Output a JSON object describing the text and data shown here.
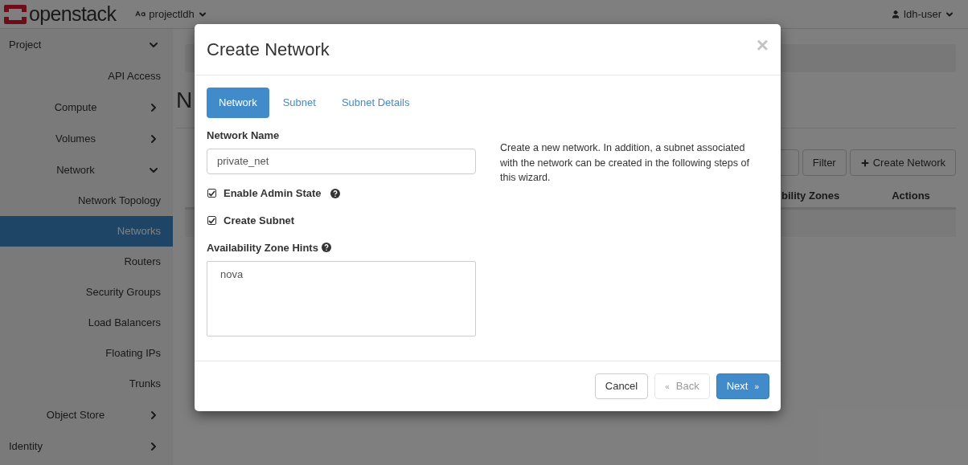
{
  "header": {
    "logo": "openstack",
    "project": "projectldh",
    "user": "ldh-user"
  },
  "sidebar": {
    "items": [
      {
        "label": "Project",
        "expanded": true,
        "children": [
          {
            "label": "API Access",
            "selected": false
          },
          {
            "label": "Compute",
            "expanded": false
          },
          {
            "label": "Volumes",
            "expanded": false
          },
          {
            "label": "Network",
            "expanded": true,
            "children": [
              {
                "label": "Network Topology",
                "selected": false
              },
              {
                "label": "Networks",
                "selected": true
              },
              {
                "label": "Routers",
                "selected": false
              },
              {
                "label": "Security Groups",
                "selected": false
              },
              {
                "label": "Load Balancers",
                "selected": false
              },
              {
                "label": "Floating IPs",
                "selected": false
              },
              {
                "label": "Trunks",
                "selected": false
              }
            ]
          },
          {
            "label": "Object Store",
            "expanded": false
          }
        ]
      },
      {
        "label": "Identity",
        "expanded": false
      }
    ]
  },
  "page": {
    "heading": "N",
    "toolbar": {
      "buttons": [
        {
          "label": "Filter",
          "kind": "plain"
        },
        {
          "label": "Create Network",
          "kind": "create"
        }
      ]
    },
    "table": {
      "columns": [
        "bility Zones",
        "Actions"
      ]
    }
  },
  "modal": {
    "title": "Create Network",
    "close": "×",
    "tabs": [
      {
        "label": "Network",
        "selected": true
      },
      {
        "label": "Subnet",
        "selected": false
      },
      {
        "label": "Subnet Details",
        "selected": false
      }
    ],
    "network_name": {
      "label": "Network Name",
      "value": "private_net"
    },
    "checkboxes": [
      {
        "label": "Enable Admin State",
        "checked": true,
        "help": true
      },
      {
        "label": "Create Subnet",
        "checked": true,
        "help": false
      }
    ],
    "az_hints": {
      "label": "Availability Zone Hints",
      "options": [
        "nova"
      ]
    },
    "description": "Create a new network. In addition, a subnet associated with the network can be created in the following steps of this wizard.",
    "buttons": [
      {
        "label": "Cancel",
        "kind": "default",
        "disabled": false
      },
      {
        "label": "Back",
        "kind": "back",
        "disabled": true,
        "glyph": "«"
      },
      {
        "label": "Next",
        "kind": "next",
        "disabled": false,
        "glyph": "»"
      }
    ]
  }
}
